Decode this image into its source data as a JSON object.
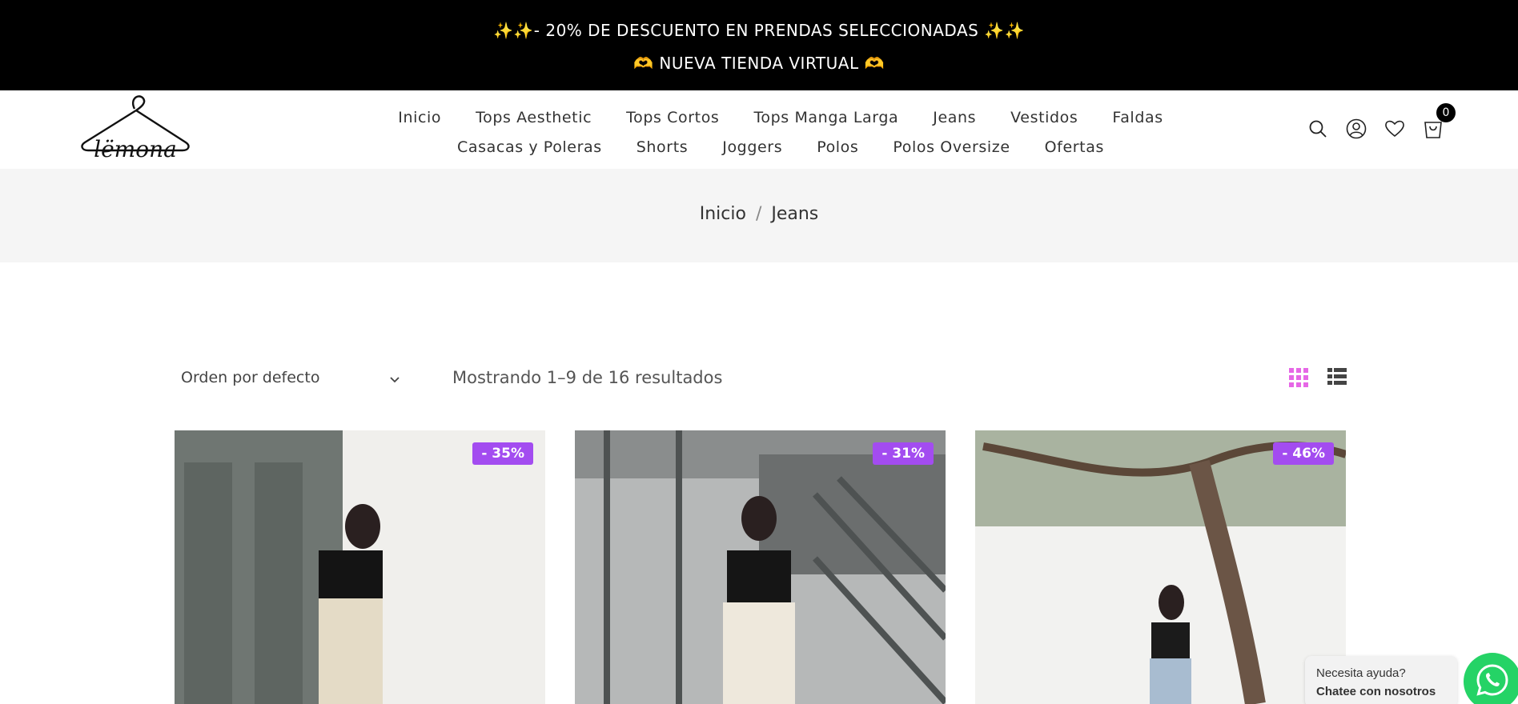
{
  "announcement": {
    "line1": "✨✨- 20% DE DESCUENTO EN PRENDAS SELECCIONADAS ✨✨",
    "line2": "🫶 NUEVA TIENDA VIRTUAL 🫶"
  },
  "header": {
    "logo_text": "lëmona",
    "nav_row1": [
      "Inicio",
      "Tops Aesthetic",
      "Tops Cortos",
      "Tops Manga Larga",
      "Jeans",
      "Vestidos",
      "Faldas"
    ],
    "nav_row2": [
      "Casacas y Poleras",
      "Shorts",
      "Joggers",
      "Polos",
      "Polos Oversize",
      "Ofertas"
    ],
    "icons": [
      "search-icon",
      "user-icon",
      "heart-icon",
      "cart-icon"
    ],
    "cart_count": "0"
  },
  "breadcrumb": {
    "home": "Inicio",
    "separator": "/",
    "current": "Jeans"
  },
  "toolbar": {
    "sort_label": "Orden por defecto",
    "results_text": "Mostrando 1–9 de 16 resultados",
    "active_view": "grid",
    "active_view_color": "#e667e6"
  },
  "products": [
    {
      "badge": "- 35%"
    },
    {
      "badge": "- 31%"
    },
    {
      "badge": "- 46%"
    }
  ],
  "chat": {
    "prefix": "Necesita ayuda?",
    "cta": "Chatee con nosotros"
  },
  "colors": {
    "badge": "#a34cf0",
    "whatsapp": "#25d366",
    "announcement_bg": "#000000"
  }
}
